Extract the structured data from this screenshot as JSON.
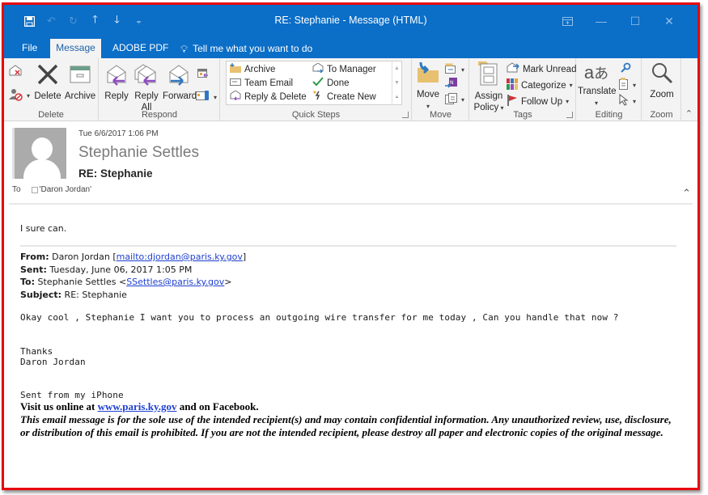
{
  "window": {
    "title": "RE: Stephanie  -  Message (HTML)",
    "controls": {
      "restore_ribbon": "ribbon-display-options",
      "minimize": "—",
      "maximize": "☐",
      "close": "✕"
    }
  },
  "quick_access": {
    "items": [
      "save",
      "undo",
      "redo",
      "previous-item",
      "next-item",
      "customize"
    ]
  },
  "tabs": [
    {
      "label": "File",
      "active": false
    },
    {
      "label": "Message",
      "active": true
    },
    {
      "label": "ADOBE PDF",
      "active": false
    }
  ],
  "tell_me": {
    "placeholder": "Tell me what you want to do"
  },
  "ribbon": {
    "delete_group": {
      "label": "Delete",
      "ignore_label": "Ignore",
      "junk_label": "Junk",
      "delete_label": "Delete",
      "archive_label": "Archive"
    },
    "respond_group": {
      "label": "Respond",
      "reply_label": "Reply",
      "reply_all_line1": "Reply",
      "reply_all_line2": "All",
      "forward_label": "Forward"
    },
    "quick_steps_group": {
      "label": "Quick Steps",
      "items": [
        {
          "label": "Archive",
          "icon": "folder-archive-icon"
        },
        {
          "label": "Team Email",
          "icon": "team-email-icon"
        },
        {
          "label": "Reply & Delete",
          "icon": "reply-delete-icon"
        },
        {
          "label": "To Manager",
          "icon": "to-manager-icon"
        },
        {
          "label": "Done",
          "icon": "checkmark-icon"
        },
        {
          "label": "Create New",
          "icon": "create-new-icon"
        }
      ]
    },
    "move_group": {
      "label": "Move",
      "move_label": "Move"
    },
    "tags_group": {
      "label": "Tags",
      "assign_policy_line1": "Assign",
      "assign_policy_line2": "Policy",
      "mark_unread_label": "Mark Unread",
      "categorize_label": "Categorize",
      "follow_up_label": "Follow Up"
    },
    "editing_group": {
      "label": "Editing",
      "translate_label": "Translate"
    },
    "zoom_group": {
      "label": "Zoom",
      "zoom_label": "Zoom"
    }
  },
  "header": {
    "date": "Tue 6/6/2017 1:06 PM",
    "sender": "Stephanie Settles",
    "subject": "RE: Stephanie",
    "to_label": "To",
    "to_value": "'Daron Jordan'"
  },
  "body": {
    "reply_text": "I sure can.",
    "quoted": {
      "from_label": "From:",
      "from_name": "Daron Jordan [",
      "from_link": "mailto:djordan@paris.ky.gov",
      "from_close": "]",
      "sent_label": "Sent:",
      "sent_value": "Tuesday, June 06, 2017 1:05 PM",
      "to_label": "To:",
      "to_name": "Stephanie Settles <",
      "to_link": "SSettles@paris.ky.gov",
      "to_close": ">",
      "subject_label": "Subject:",
      "subject_value": "RE: Stephanie"
    },
    "message": "Okay cool , Stephanie I want you to process an outgoing wire transfer for me today , Can you handle that now ?",
    "thanks": "Thanks",
    "signature_name": "Daron Jordan",
    "sent_from": "Sent from my iPhone",
    "visit_prefix": "Visit us online at ",
    "visit_link": "www.paris.ky.gov",
    "visit_suffix": " and on Facebook.",
    "disclaimer": "This email message is for the sole use of the intended recipient(s) and may contain confidential information. Any unauthorized review, use, disclosure, or distribution of this email is prohibited. If you are not the intended recipient, please destroy all paper and electronic copies of the original message."
  },
  "colors": {
    "titlebar": "#0b6ec7",
    "ribbon": "#f3f3f3",
    "annotation_border": "#e8060e",
    "link": "#1e3fd0",
    "reply_arrow": "#8e4fc0",
    "forward_arrow": "#2f78c4"
  }
}
